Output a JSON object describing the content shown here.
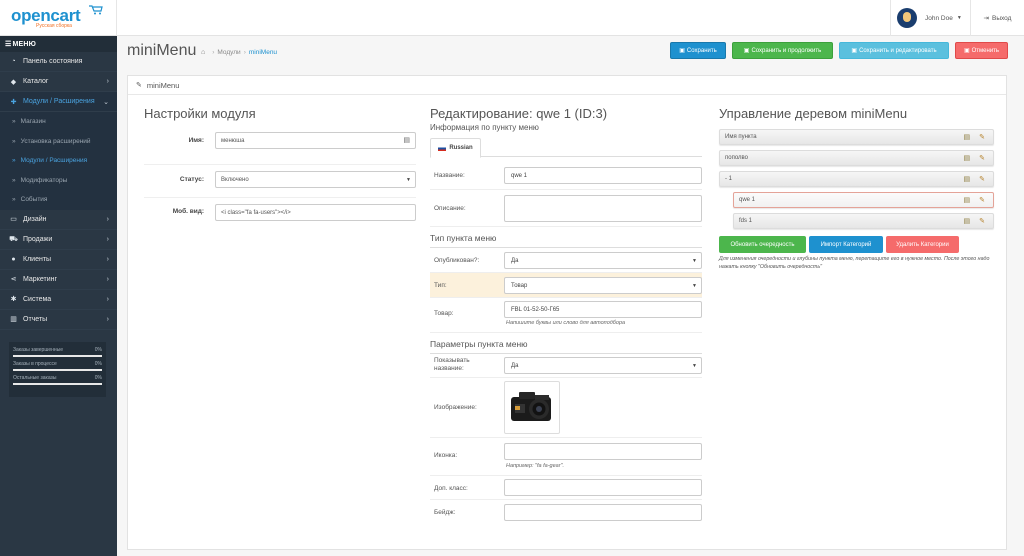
{
  "header": {
    "logo_text": "opencart",
    "logo_sub": "Русская сборка",
    "user_name": "John Doe",
    "logout": "Выход"
  },
  "sidebar": {
    "menu_title": "МЕНЮ",
    "items": [
      {
        "label": "Панель состояния",
        "icon": "dashboard-icon",
        "arrow": false
      },
      {
        "label": "Каталог",
        "icon": "tag-icon",
        "arrow": true
      },
      {
        "label": "Модули / Расширения",
        "icon": "puzzle-icon",
        "arrow": true,
        "active": true
      }
    ],
    "subitems": [
      {
        "label": "Магазин"
      },
      {
        "label": "Установка расширений"
      },
      {
        "label": "Модули / Расширения",
        "active": true
      },
      {
        "label": "Модификаторы"
      },
      {
        "label": "События"
      }
    ],
    "items2": [
      {
        "label": "Дизайн",
        "icon": "desktop-icon"
      },
      {
        "label": "Продажи",
        "icon": "cart-icon"
      },
      {
        "label": "Клиенты",
        "icon": "user-icon"
      },
      {
        "label": "Маркетинг",
        "icon": "share-icon"
      },
      {
        "label": "Система",
        "icon": "cog-icon"
      },
      {
        "label": "Отчеты",
        "icon": "bar-chart-icon"
      }
    ],
    "progress": [
      {
        "label": "Заказы завершенные",
        "value": "0%"
      },
      {
        "label": "Заказы в процессе",
        "value": "0%"
      },
      {
        "label": "Остальные заказы",
        "value": "0%"
      }
    ]
  },
  "page": {
    "title": "miniMenu",
    "breadcrumb": [
      "Модули",
      "miniMenu"
    ],
    "buttons": {
      "save": "Сохранить",
      "save_continue": "Сохранить и продолжить",
      "save_edit": "Сохранить и редактировать",
      "cancel": "Отменить"
    },
    "panel_title": "miniMenu"
  },
  "settings": {
    "heading": "Настройки модуля",
    "name_label": "Имя:",
    "name_value": "менюша",
    "status_label": "Статус:",
    "status_value": "Включено",
    "mobile_label": "Моб. вид:",
    "mobile_value": "<i class=\"fa fa-users\"></i>"
  },
  "edit": {
    "heading": "Редактирование: qwe 1 (ID:3)",
    "info_title": "Информация по пункту меню",
    "tab_language": "Russian",
    "name_label": "Название:",
    "name_value": "qwe 1",
    "desc_label": "Описание:",
    "desc_value": "",
    "type_section": "Тип пункта меню",
    "published_label": "Опубликован?:",
    "published_value": "Да",
    "type_label": "Тип:",
    "type_value": "Товар",
    "product_label": "Товар:",
    "product_value": "FBL 01-52-50-Г65",
    "product_help": "Напишите буквы или слово для автоподбора",
    "params_section": "Параметры пункта меню",
    "show_name_label": "Показывать название:",
    "show_name_value": "Да",
    "image_label": "Изображение:",
    "icon_label": "Иконка:",
    "icon_value": "",
    "icon_help": "Например: \"fa fa-gear\".",
    "class_label": "Доп. класс:",
    "class_value": "",
    "badge_label": "Бейдж:",
    "badge_value": ""
  },
  "tree": {
    "heading": "Управление деревом miniMenu",
    "items": [
      {
        "label": "Имя пункта",
        "level": 0
      },
      {
        "label": "пополво",
        "level": 0
      },
      {
        "label": "- 1",
        "level": 0
      },
      {
        "label": "qwe 1",
        "level": 1,
        "selected": true
      },
      {
        "label": "fds 1",
        "level": 1
      }
    ],
    "btn_update": "Обновить очередность",
    "btn_import": "Импорт Категорий",
    "btn_delete": "Удалить Категории",
    "note": "Для изменения очередности и глубины пункта меню, перетащите его в нужное место. После этого надо нажать кнопку \"Обновить очередность\""
  }
}
